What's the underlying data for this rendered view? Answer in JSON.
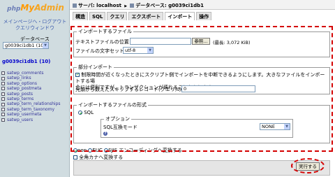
{
  "left": {
    "logo": {
      "php": "php",
      "my": "My",
      "admin": "Admin"
    },
    "links": [
      "メインページへ・ログアウト",
      "クエリウィンドウ"
    ],
    "database_label": "データベース",
    "database_select": "g0039ci1db1 (10)",
    "db_name": "g0039ci1db1 (10)",
    "tables": [
      "satwp_comments",
      "satwp_links",
      "satwp_options",
      "satwp_postmeta",
      "satwp_posts",
      "satwp_terms",
      "satwp_term_relationships",
      "satwp_term_taxonomy",
      "satwp_usermeta",
      "satwp_users"
    ]
  },
  "topbar": {
    "server_label": "サーバ: localhost",
    "sep": "▶",
    "db_label": "データベース: g0039ci1db1"
  },
  "tabs": [
    "構造",
    "SQL",
    "クエリ",
    "エクスポート",
    "インポート",
    "操作"
  ],
  "import_file": {
    "legend": "インポートするファイル",
    "location_label": "テキストファイルの位置",
    "browse_label": "参照...",
    "max_label": "(最長: 3,072 KiB)",
    "charset_label": "ファイルの文字セット:",
    "charset_value": "utf-8"
  },
  "partial": {
    "legend": "部分インポート",
    "interrupt_text": "制限時間が近くなったときにスクリプト側でインポートを中断できるようにします。大きなファイルをインポートする場",
    "interrupt_text2": "合には便利ですが、トランザクションが壊れることもあります",
    "skip_label": "先頭から数えたスキップするレコード(クエリ)の数",
    "skip_value": "0"
  },
  "format": {
    "legend": "インポートするファイルの形式",
    "sql_label": "SQL",
    "options_legend": "オプション",
    "compat_label": "SQL互換モード",
    "compat_value": "NONE",
    "help_glyph": "?"
  },
  "encoding": {
    "non": "non",
    "euc": "EUC",
    "sjis": "SJIS",
    "suffix": "エンコーディングへ変換する"
  },
  "kana": {
    "label": "全角カナへ変換する"
  },
  "submit": {
    "label": "実行する"
  }
}
